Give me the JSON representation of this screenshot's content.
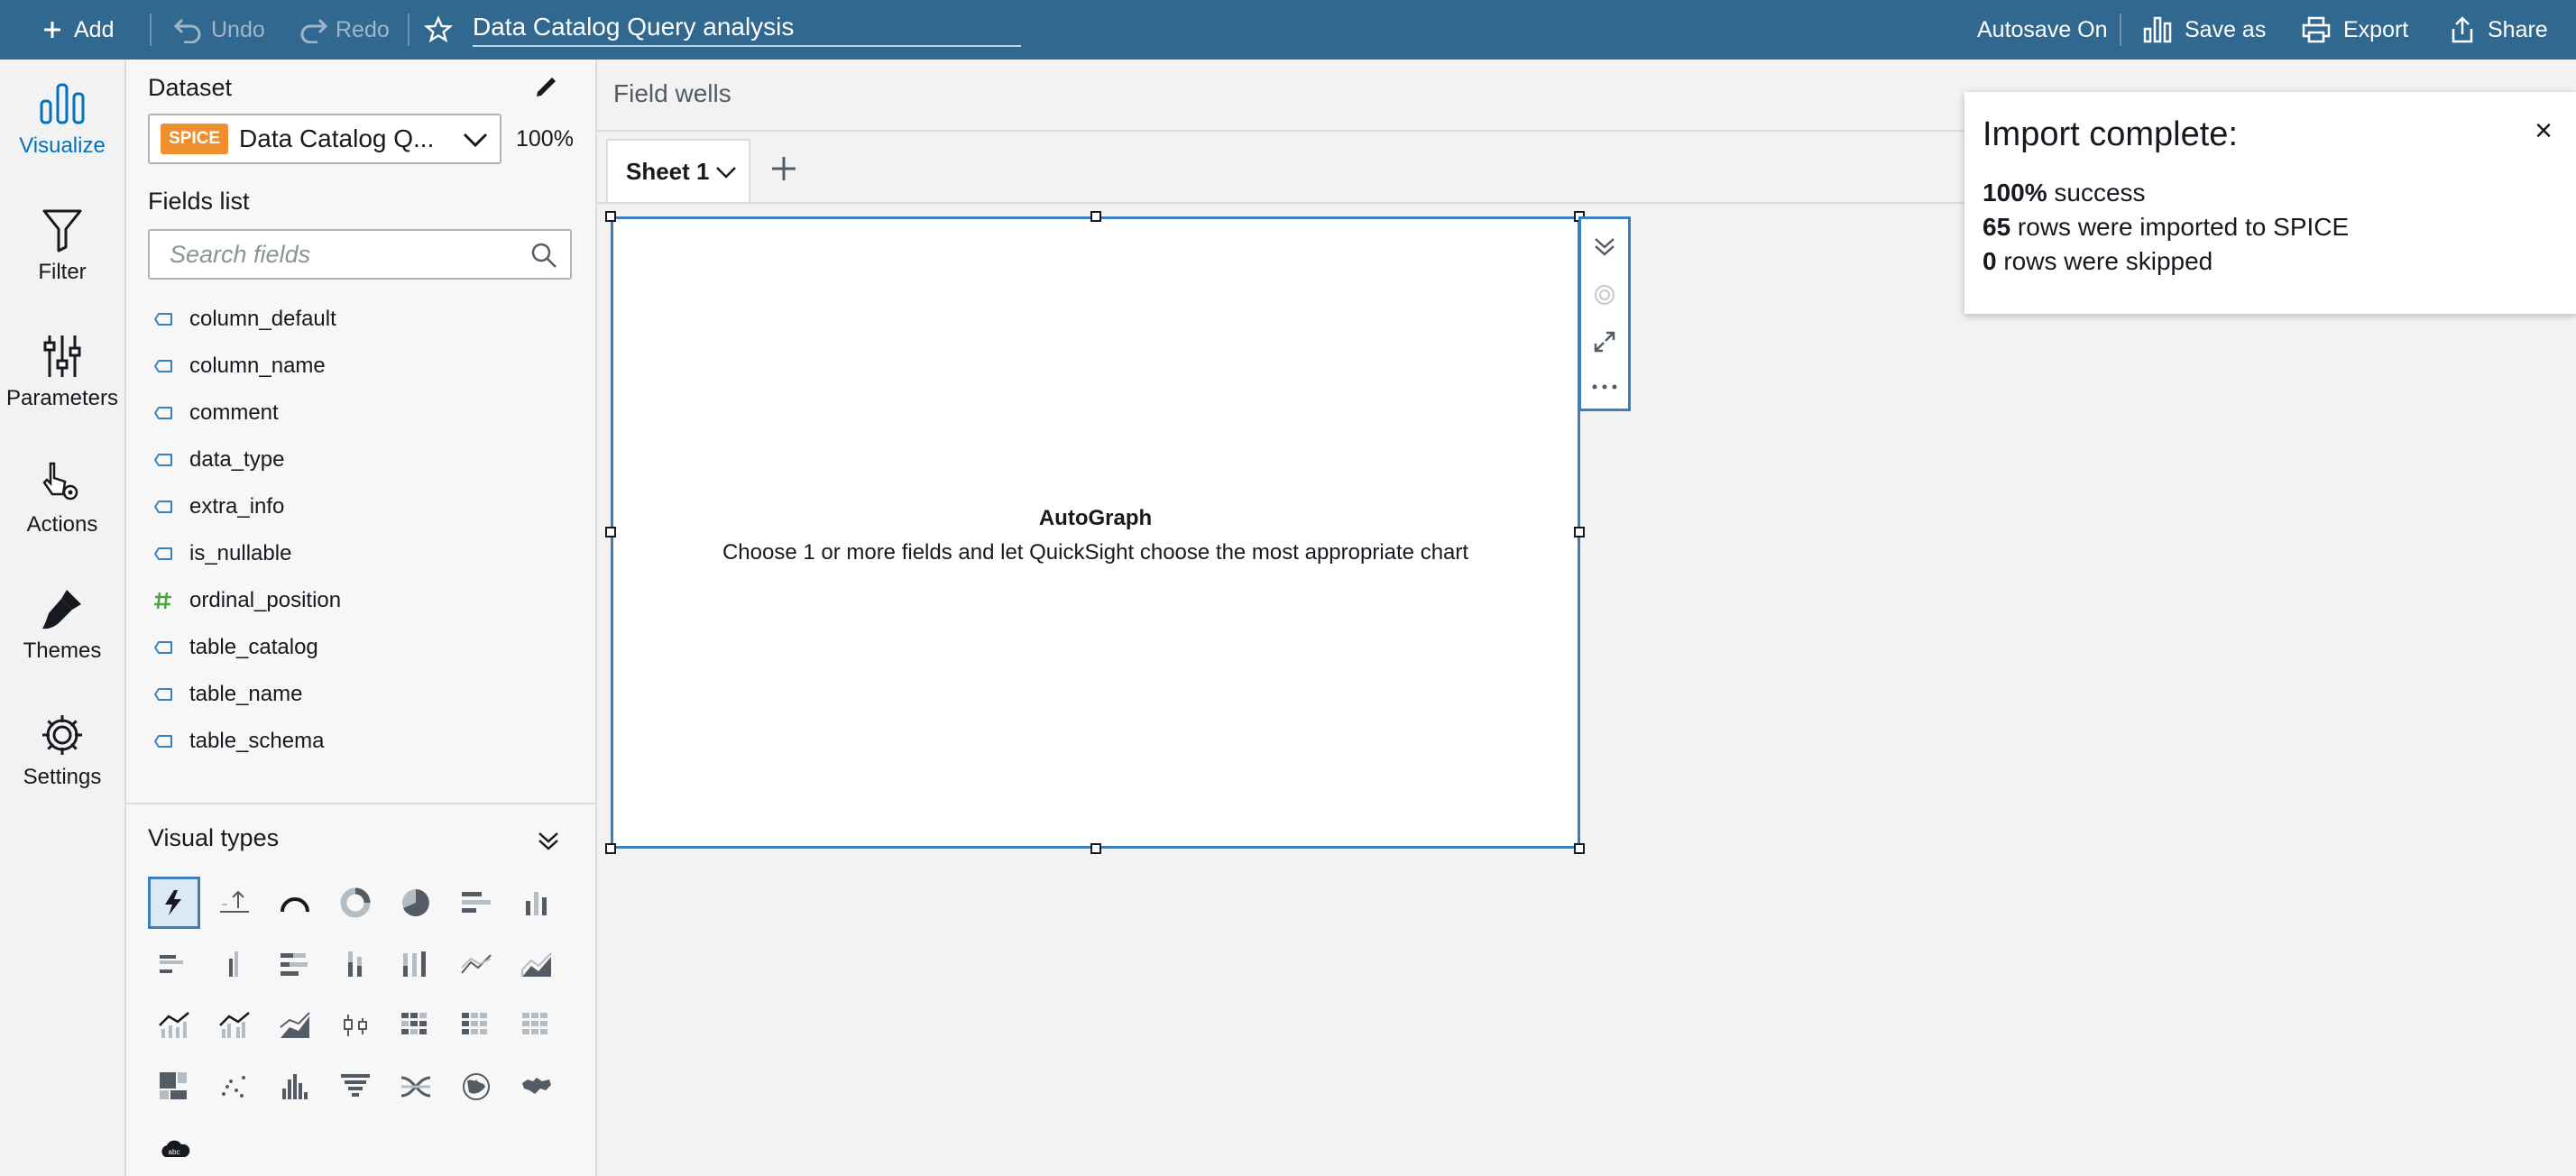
{
  "topbar": {
    "add_label": "Add",
    "undo_label": "Undo",
    "redo_label": "Redo",
    "analysis_title": "Data Catalog Query analysis",
    "autosave_label": "Autosave On",
    "save_as_label": "Save as",
    "export_label": "Export",
    "share_label": "Share",
    "bg_color": "#31688f"
  },
  "rail": {
    "items": [
      {
        "label": "Visualize",
        "icon": "bar-chart-icon",
        "active": true
      },
      {
        "label": "Filter",
        "icon": "funnel-icon"
      },
      {
        "label": "Parameters",
        "icon": "sliders-icon"
      },
      {
        "label": "Actions",
        "icon": "pointer-gear-icon"
      },
      {
        "label": "Themes",
        "icon": "brush-icon"
      },
      {
        "label": "Settings",
        "icon": "gear-icon"
      }
    ]
  },
  "panel": {
    "dataset_heading": "Dataset",
    "spice_badge": "SPICE",
    "dataset_name": "Data Catalog Q...",
    "dataset_percent": "100%",
    "fields_heading": "Fields list",
    "search_placeholder": "Search fields",
    "fields": [
      {
        "name": "column_default",
        "type": "dimension"
      },
      {
        "name": "column_name",
        "type": "dimension"
      },
      {
        "name": "comment",
        "type": "dimension"
      },
      {
        "name": "data_type",
        "type": "dimension"
      },
      {
        "name": "extra_info",
        "type": "dimension"
      },
      {
        "name": "is_nullable",
        "type": "dimension"
      },
      {
        "name": "ordinal_position",
        "type": "measure"
      },
      {
        "name": "table_catalog",
        "type": "dimension"
      },
      {
        "name": "table_name",
        "type": "dimension"
      },
      {
        "name": "table_schema",
        "type": "dimension"
      }
    ],
    "visual_types_heading": "Visual types"
  },
  "main": {
    "field_wells_label": "Field wells",
    "sheet_label": "Sheet 1",
    "autograph_title": "AutoGraph",
    "autograph_subtitle": "Choose 1 or more fields and let QuickSight choose the most appropriate chart"
  },
  "notice": {
    "title": "Import complete:",
    "line1_bold": "100%",
    "line1_rest": " success",
    "line2_bold": "65",
    "line2_rest": " rows were imported to SPICE",
    "line3_bold": "0",
    "line3_rest": " rows were skipped",
    "close_glyph": "×"
  },
  "colors": {
    "accent": "#0073bb",
    "selection_border": "#3b80bd",
    "spice_badge": "#f08f2e",
    "measure_icon": "#4ca443"
  }
}
